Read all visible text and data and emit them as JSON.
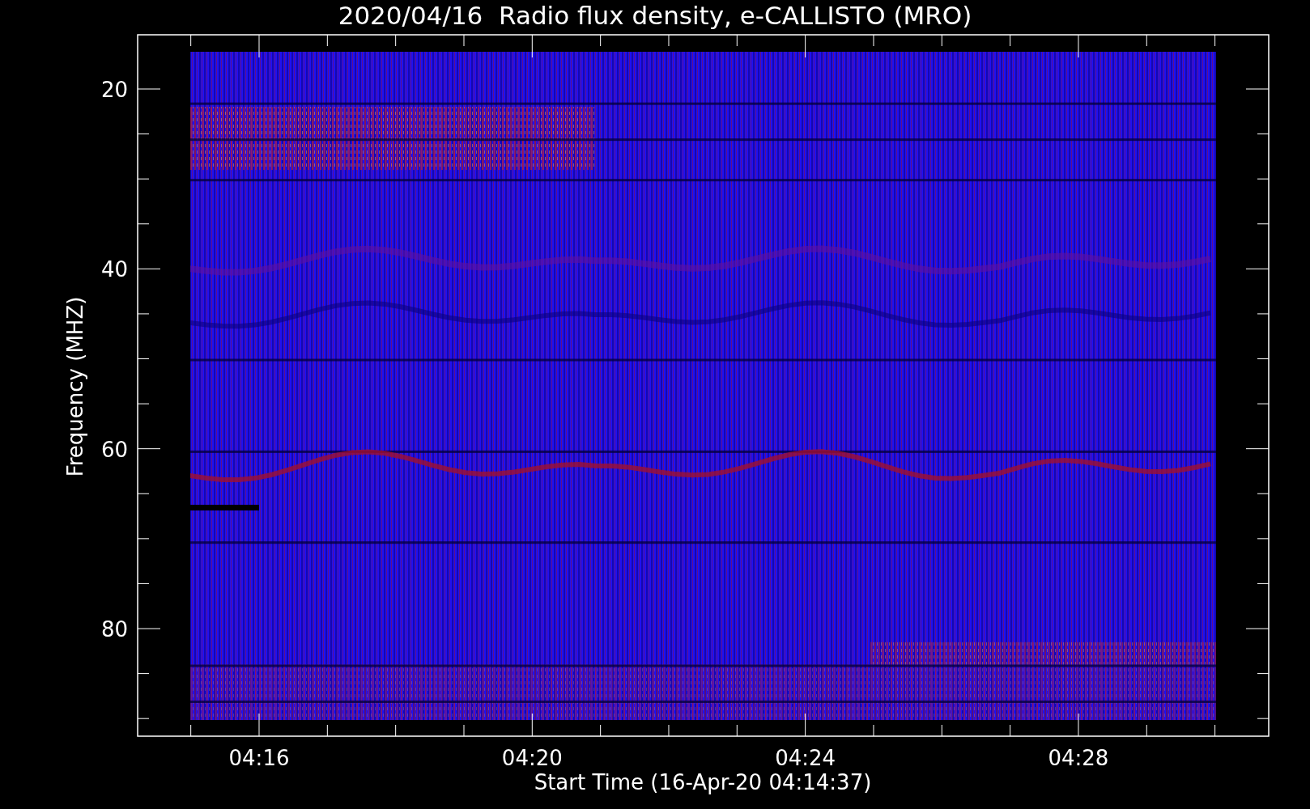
{
  "title": "2020/04/16  Radio flux density, e-CALLISTO (MRO)",
  "y_axis": {
    "label": "Frequency (MHZ)",
    "ticks": [
      "20",
      "40",
      "60",
      "80"
    ]
  },
  "x_axis": {
    "label": "Start Time (16-Apr-20 04:14:37)",
    "ticks": [
      "04:16",
      "04:20",
      "04:24",
      "04:28"
    ]
  }
}
